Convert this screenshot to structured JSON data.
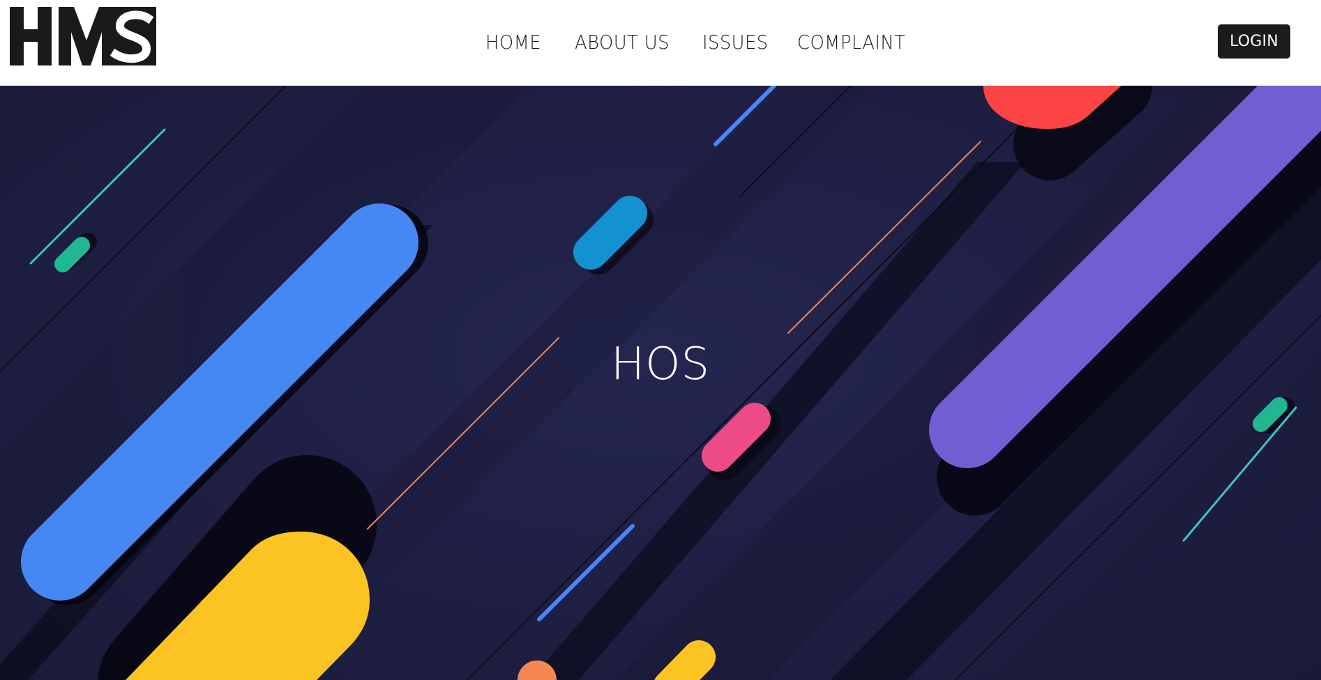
{
  "header": {
    "logo_text": "HMS",
    "nav": [
      "HOME",
      "ABOUT US",
      "ISSUES",
      "COMPLAINT"
    ],
    "login_label": "LOGIN"
  },
  "hero": {
    "title": "HOS",
    "colors": {
      "background": "#202046",
      "blue": "#4588f4",
      "purple": "#725dd2",
      "red": "#fd4444",
      "yellow": "#fcc423",
      "sky": "#1491d1",
      "pink": "#eb4c85",
      "green": "#20b893",
      "orange": "#f48752",
      "teal": "#40c4c0"
    }
  }
}
